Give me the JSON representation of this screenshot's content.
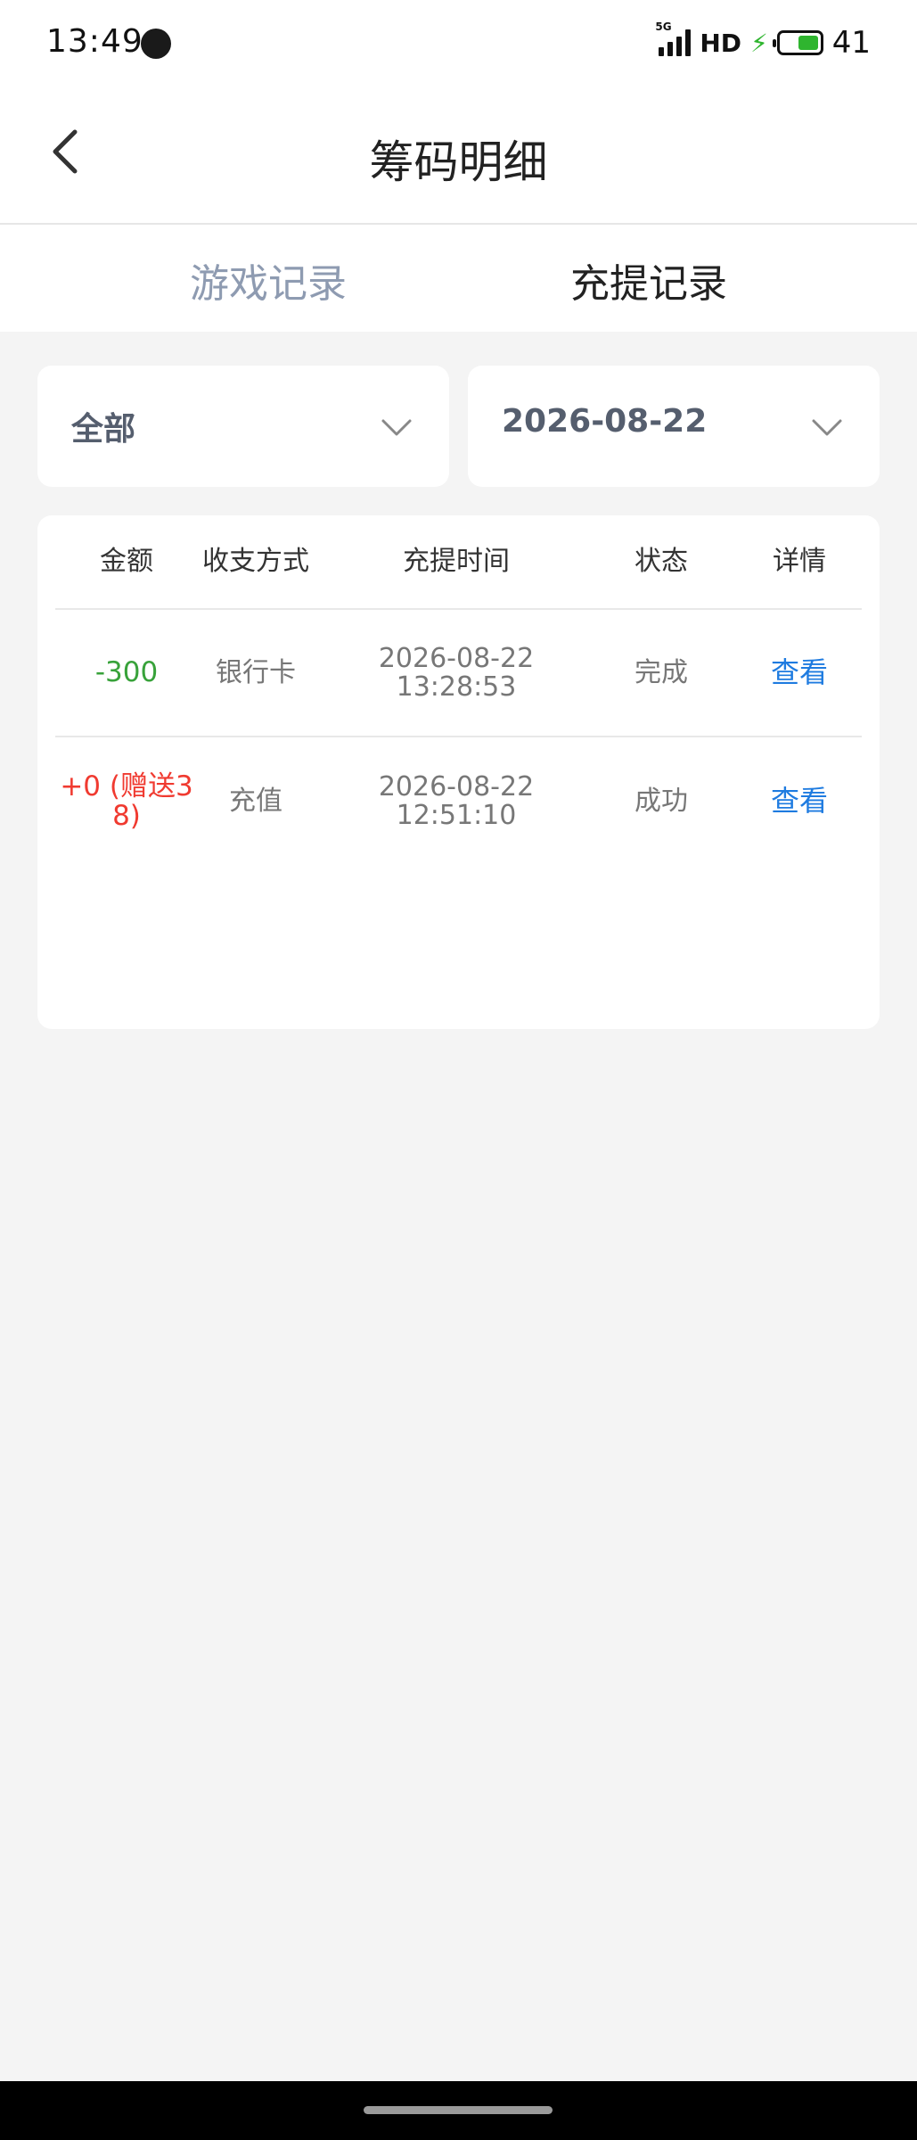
{
  "status_bar": {
    "time": "13:49",
    "network_type": "5G",
    "hd": "HD",
    "battery_level": "41",
    "battery_fraction": 0.41
  },
  "header": {
    "title": "筹码明细",
    "back_icon": "chevron-left-icon"
  },
  "tabs": [
    {
      "label": "游戏记录",
      "active": false
    },
    {
      "label": "充提记录",
      "active": true
    }
  ],
  "filters": {
    "type": {
      "value": "全部",
      "icon": "chevron-down-icon"
    },
    "date": {
      "value": "2026-08-22",
      "icon": "chevron-down-icon"
    }
  },
  "table": {
    "headers": {
      "amount": "金额",
      "method": "收支方式",
      "time": "充提时间",
      "status": "状态",
      "detail": "详情"
    },
    "rows": [
      {
        "amount_line1": "-300",
        "amount_line2": "",
        "method": "银行卡",
        "date": "2026-08-22",
        "clock": "13:28:53",
        "status": "完成",
        "detail": "查看"
      },
      {
        "amount_line1": "+0 (赠送3",
        "amount_line2": "8)",
        "method": "充值",
        "date": "2026-08-22",
        "clock": "12:51:10",
        "status": "成功",
        "detail": "查看"
      }
    ]
  },
  "colors": {
    "negative_amount": "#38a23a",
    "positive_amount": "#f03a30",
    "link": "#1e7be0",
    "inactive_tab": "#8e9bb1"
  }
}
